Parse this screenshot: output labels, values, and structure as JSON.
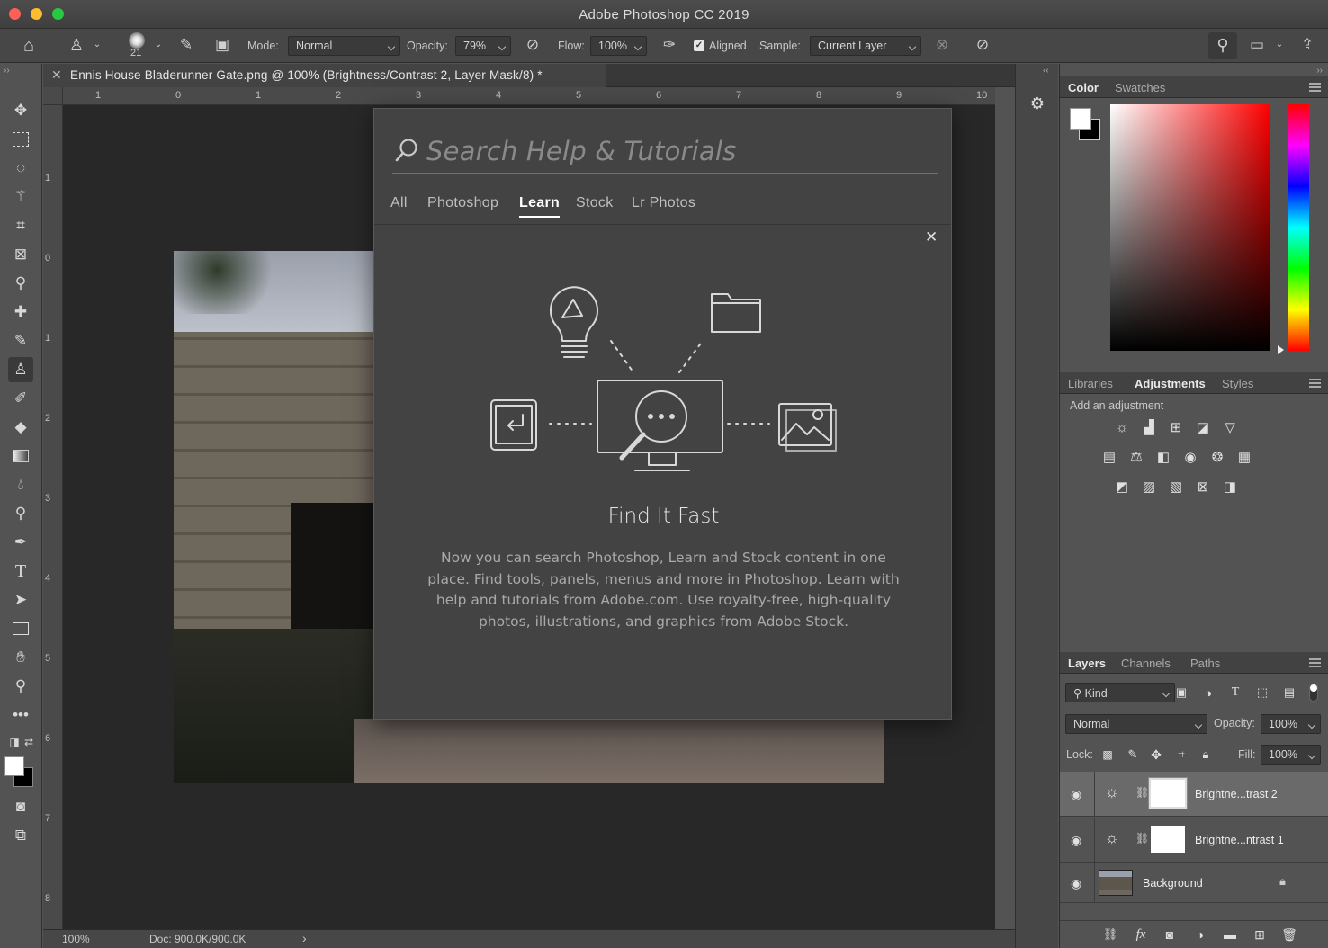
{
  "window": {
    "title": "Adobe Photoshop CC 2019"
  },
  "options_bar": {
    "brush_size": "21",
    "mode_label": "Mode:",
    "mode_value": "Normal",
    "opacity_label": "Opacity:",
    "opacity_value": "79%",
    "flow_label": "Flow:",
    "flow_value": "100%",
    "aligned_label": "Aligned",
    "aligned_checked": true,
    "sample_label": "Sample:",
    "sample_value": "Current Layer"
  },
  "document": {
    "tab_title": "Ennis House Bladerunner Gate.png @ 100% (Brightness/Contrast 2, Layer Mask/8) *",
    "zoom": "100%",
    "doc_size": "Doc: 900.0K/900.0K"
  },
  "rulers": {
    "horizontal": [
      "1",
      "0",
      "1",
      "2",
      "3",
      "4",
      "5",
      "6",
      "7",
      "8",
      "9",
      "10"
    ],
    "vertical": [
      "1",
      "0",
      "1",
      "2",
      "3",
      "4",
      "5",
      "6",
      "7",
      "8"
    ]
  },
  "help_dialog": {
    "search_placeholder": "Search Help & Tutorials",
    "tabs": [
      "All",
      "Photoshop",
      "Learn",
      "Stock",
      "Lr Photos"
    ],
    "active_tab": "Learn",
    "heading": "Find It Fast",
    "body": "Now you can search Photoshop, Learn and Stock content in one place. Find tools, panels, menus and more in Photoshop. Learn with help and tutorials from Adobe.com. Use royalty-free, high-quality photos, illustrations, and graphics from Adobe Stock."
  },
  "color_panel": {
    "tabs": [
      "Color",
      "Swatches"
    ],
    "foreground": "#ffffff",
    "background": "#000000",
    "hue_color": "#ff0000"
  },
  "adjustments_panel": {
    "tabs": [
      "Libraries",
      "Adjustments",
      "Styles"
    ],
    "label": "Add an adjustment"
  },
  "layers_panel": {
    "tabs": [
      "Layers",
      "Channels",
      "Paths"
    ],
    "filter_kind": "Kind",
    "blend_mode": "Normal",
    "opacity_label": "Opacity:",
    "opacity_value": "100%",
    "lock_label": "Lock:",
    "fill_label": "Fill:",
    "fill_value": "100%",
    "layers": [
      {
        "name": "Brightne...trast 2",
        "selected": true
      },
      {
        "name": "Brightne...ntrast 1",
        "selected": false
      },
      {
        "name": "Background",
        "selected": false,
        "locked": true
      }
    ]
  },
  "colors": {
    "accent": "#2a7de1",
    "app_bg": "#535353"
  }
}
